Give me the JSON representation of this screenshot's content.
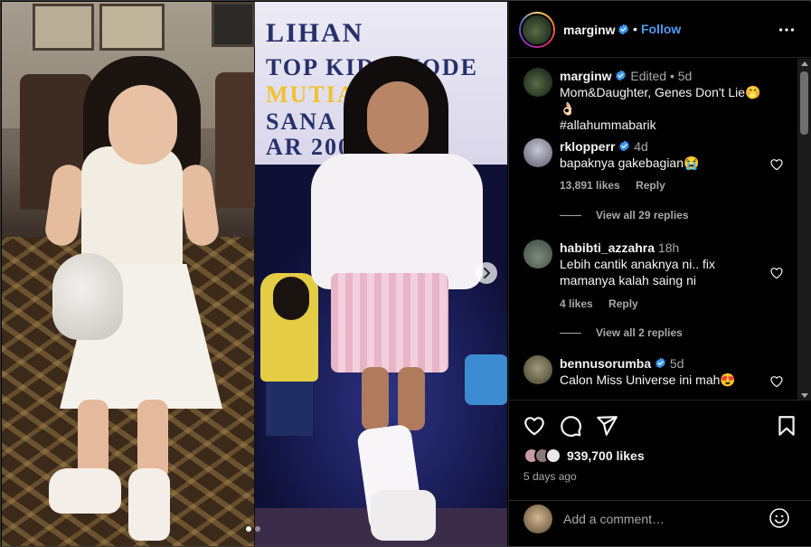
{
  "post": {
    "author": "marginw",
    "follow_label": "Follow",
    "separator": "•"
  },
  "media": {
    "left_photo_banner": [
      "LIHAN",
      "TOP KIDS MODE",
      "MUTIA",
      "SANA",
      "AR 200"
    ],
    "carousel_count": 2,
    "carousel_index": 0
  },
  "caption": {
    "user": "marginw",
    "meta": "Edited •",
    "age": "5d",
    "text_line1": "Mom&Daughter, Genes Don't Lie🤭👌🏻",
    "text_line2": "#allahummabarik"
  },
  "comments": [
    {
      "user": "rklopperr",
      "verified": true,
      "age": "4d",
      "text": "bapaknya gakebagian😭",
      "likes": "13,891 likes",
      "reply": "Reply",
      "view_replies": "View all 29 replies"
    },
    {
      "user": "habibti_azzahra",
      "verified": false,
      "age": "18h",
      "text": "Lebih cantik anaknya ni.. fix mamanya kalah saing ni",
      "likes": "4 likes",
      "reply": "Reply",
      "view_replies": "View all 2 replies"
    },
    {
      "user": "bennusorumba",
      "verified": true,
      "age": "5d",
      "text": "Calon Miss Universe ini mah😍",
      "likes": "",
      "reply": "",
      "view_replies": ""
    }
  ],
  "stats": {
    "likes": "939,700 likes",
    "time_ago": "5 days ago"
  },
  "add_comment": {
    "placeholder": "Add a comment…"
  },
  "icons": {
    "verified": "verified-badge-icon",
    "more": "more-options-icon",
    "like": "heart-icon",
    "comment": "comment-icon",
    "share": "share-icon",
    "save": "bookmark-icon",
    "emoji": "emoji-icon",
    "next": "chevron-right-icon"
  },
  "colors": {
    "background": "#000000",
    "text": "#f5f5f5",
    "muted": "#a8a8a8",
    "link": "#4f9cf5",
    "verified": "#3897f0",
    "divider": "#262626"
  }
}
